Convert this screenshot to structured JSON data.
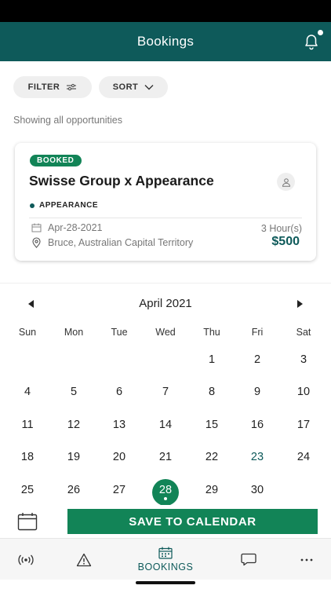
{
  "header": {
    "title": "Bookings"
  },
  "filters": {
    "filter_label": "FILTER",
    "sort_label": "SORT"
  },
  "subtitle": "Showing all opportunities",
  "card": {
    "status": "BOOKED",
    "title": "Swisse Group x Appearance",
    "category": "APPEARANCE",
    "date": "Apr-28-2021",
    "location": "Bruce, Australian Capital Territory",
    "duration": "3 Hour(s)",
    "price": "$500"
  },
  "calendar": {
    "month": "April 2021",
    "weekdays": [
      "Sun",
      "Mon",
      "Tue",
      "Wed",
      "Thu",
      "Fri",
      "Sat"
    ],
    "weeks": [
      [
        "",
        "",
        "",
        "",
        "1",
        "2",
        "3"
      ],
      [
        "4",
        "5",
        "6",
        "7",
        "8",
        "9",
        "10"
      ],
      [
        "11",
        "12",
        "13",
        "14",
        "15",
        "16",
        "17"
      ],
      [
        "18",
        "19",
        "20",
        "21",
        "22",
        "23",
        "24"
      ],
      [
        "25",
        "26",
        "27",
        "28",
        "29",
        "30",
        ""
      ]
    ],
    "selected_day": "28",
    "highlight_day": "23"
  },
  "save_button": "SAVE TO CALENDAR",
  "tabs": [
    {
      "icon": "broadcast-icon",
      "label": ""
    },
    {
      "icon": "warning-icon",
      "label": ""
    },
    {
      "icon": "calendar-icon",
      "label": "BOOKINGS"
    },
    {
      "icon": "chat-icon",
      "label": ""
    },
    {
      "icon": "more-icon",
      "label": ""
    }
  ],
  "colors": {
    "primary": "#0e5a5a",
    "accent": "#128457"
  }
}
